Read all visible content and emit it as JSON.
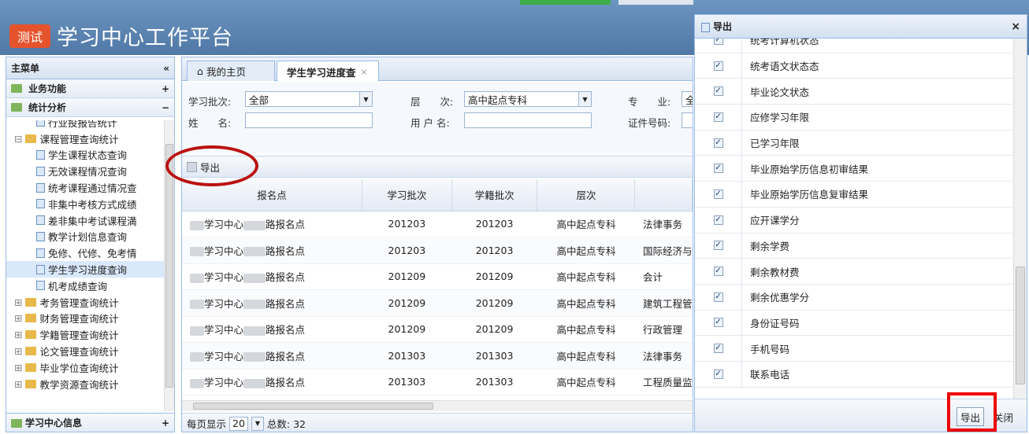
{
  "header": {
    "badge": "测试",
    "title": "学习中心工作平台"
  },
  "sidebar": {
    "title": "主菜单",
    "collapse_icon": "«",
    "sections": [
      {
        "label": "业务功能",
        "toggle": "+"
      },
      {
        "label": "统计分析",
        "toggle": "−"
      }
    ],
    "tree": [
      {
        "label": "行业投报告统计",
        "type": "leaf",
        "indent": 2
      },
      {
        "label": "课程管理查询统计",
        "type": "folder",
        "indent": 0,
        "expander": "⊟"
      },
      {
        "label": "学生课程状态查询",
        "type": "leaf",
        "indent": 2
      },
      {
        "label": "无效课程情况查询",
        "type": "leaf",
        "indent": 2
      },
      {
        "label": "统考课程通过情况查",
        "type": "leaf",
        "indent": 2
      },
      {
        "label": "非集中考核方式成绩",
        "type": "leaf",
        "indent": 2
      },
      {
        "label": "差非集中考试课程満",
        "type": "leaf",
        "indent": 2
      },
      {
        "label": "教学计划信息查询",
        "type": "leaf",
        "indent": 2
      },
      {
        "label": "免修、代修、免考情",
        "type": "leaf",
        "indent": 2
      },
      {
        "label": "学生学习进度查询",
        "type": "leaf",
        "indent": 2,
        "selected": true
      },
      {
        "label": "机考成绩查询",
        "type": "leaf",
        "indent": 2
      },
      {
        "label": "考务管理查询统计",
        "type": "folder",
        "indent": 0,
        "expander": "⊞"
      },
      {
        "label": "财务管理查询统计",
        "type": "folder",
        "indent": 0,
        "expander": "⊞"
      },
      {
        "label": "学籍管理查询统计",
        "type": "folder",
        "indent": 0,
        "expander": "⊞"
      },
      {
        "label": "论文管理查询统计",
        "type": "folder",
        "indent": 0,
        "expander": "⊞"
      },
      {
        "label": "毕业学位查询统计",
        "type": "folder",
        "indent": 0,
        "expander": "⊞"
      },
      {
        "label": "教学资源查询统计",
        "type": "folder",
        "indent": 0,
        "expander": "⊞"
      }
    ],
    "bottom": {
      "label": "学习中心信息",
      "toggle": "+"
    }
  },
  "tabs": [
    {
      "label": "我的主页"
    },
    {
      "label": "学生学习进度查",
      "close": "×"
    }
  ],
  "form": {
    "batch_label": "学习批次:",
    "batch_value": "全部",
    "level_label": "层　　次:",
    "level_value": "高中起点专科",
    "major_label": "专　　业:",
    "major_value": "全",
    "name_label": "姓　　名:",
    "name_value": "",
    "user_label": "用 户 名:",
    "user_value": "",
    "id_label": "证件号码:",
    "id_value": ""
  },
  "toolbar": {
    "export_label": "导出"
  },
  "grid": {
    "columns": [
      "报名点",
      "学习批次",
      "学籍批次",
      "层次",
      ""
    ],
    "rows": [
      {
        "site_a": "学习中心",
        "site_b": "路报名点",
        "batch": "201203",
        "enroll": "201203",
        "level": "高中起点专科",
        "major": "法律事务"
      },
      {
        "site_a": "学习中心",
        "site_b": "路报名点",
        "batch": "201203",
        "enroll": "201203",
        "level": "高中起点专科",
        "major": "国际经济与"
      },
      {
        "site_a": "学习中心",
        "site_b": "路报名点",
        "batch": "201209",
        "enroll": "201209",
        "level": "高中起点专科",
        "major": "会计"
      },
      {
        "site_a": "学习中心",
        "site_b": "路报名点",
        "batch": "201209",
        "enroll": "201209",
        "level": "高中起点专科",
        "major": "建筑工程管"
      },
      {
        "site_a": "学习中心",
        "site_b": "路报名点",
        "batch": "201209",
        "enroll": "201209",
        "level": "高中起点专科",
        "major": "行政管理"
      },
      {
        "site_a": "学习中心",
        "site_b": "路报名点",
        "batch": "201303",
        "enroll": "201303",
        "level": "高中起点专科",
        "major": "法律事务"
      },
      {
        "site_a": "学习中心",
        "site_b": "路报名点",
        "batch": "201303",
        "enroll": "201303",
        "level": "高中起点专科",
        "major": "工程质量监"
      }
    ]
  },
  "pager": {
    "per_page_label": "每页显示",
    "per_page": "20",
    "total": "总数: 32"
  },
  "dialog": {
    "title": "导出",
    "close": "×",
    "items": [
      "统考计算机状态",
      "统考语文状态态",
      "毕业论文状态",
      "应修学习年限",
      "已学习年限",
      "毕业原始学历信息初审结果",
      "毕业原始学历信息复审结果",
      "应开课学分",
      "剩余学费",
      "剩余教材费",
      "剩余优惠学分",
      "身份证号码",
      "手机号码",
      "联系电话"
    ],
    "check": "✓",
    "export_btn": "导出",
    "close_btn": "关闭"
  },
  "colors": {
    "header": "#5b84b1",
    "badge": "#e5532d",
    "highlight": "#e00000"
  }
}
